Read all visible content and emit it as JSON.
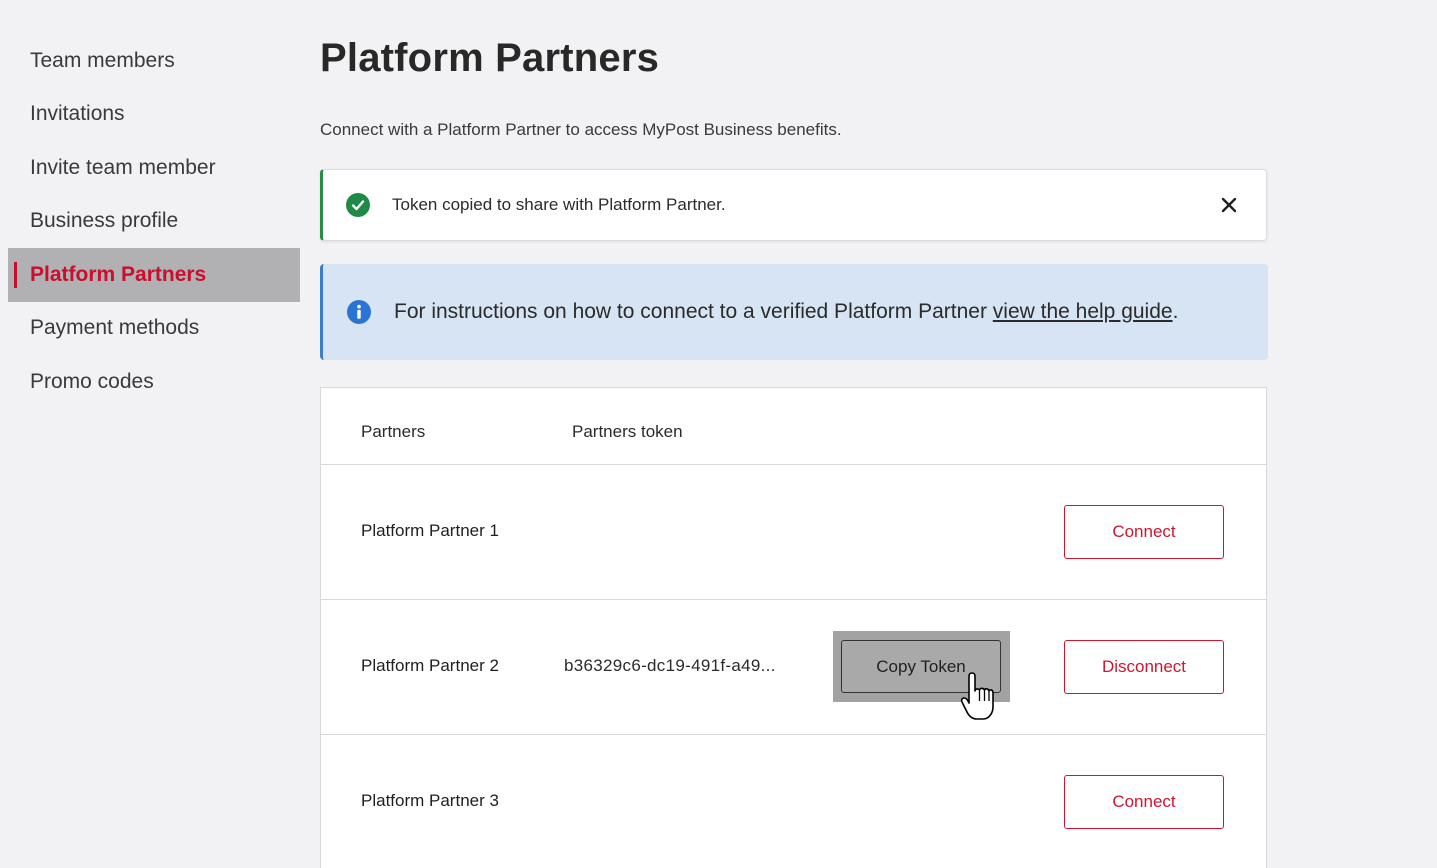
{
  "sidebar": {
    "items": [
      {
        "label": "Team members"
      },
      {
        "label": "Invitations"
      },
      {
        "label": "Invite team member"
      },
      {
        "label": "Business profile"
      },
      {
        "label": "Platform Partners",
        "active": true
      },
      {
        "label": "Payment methods"
      },
      {
        "label": "Promo codes"
      }
    ]
  },
  "page": {
    "title": "Platform Partners",
    "subtitle": "Connect with a Platform Partner to access MyPost Business benefits."
  },
  "toast": {
    "message": "Token copied to share with Platform Partner.",
    "icon": "check-circle-icon",
    "close_icon": "close-icon"
  },
  "info": {
    "text": "For instructions on how to connect to a verified Platform Partner ",
    "link_text": "view the help guide",
    "suffix": ".",
    "icon": "info-icon"
  },
  "table": {
    "headers": {
      "partners": "Partners",
      "token": "Partners token"
    },
    "rows": [
      {
        "name": "Platform Partner 1",
        "token": "",
        "action": "Connect"
      },
      {
        "name": "Platform Partner 2",
        "token": "b36329c6-dc19-491f-a49...",
        "copy_label": "Copy Token",
        "action": "Disconnect"
      },
      {
        "name": "Platform Partner 3",
        "token": "",
        "action": "Connect"
      }
    ]
  },
  "colors": {
    "accent_red": "#d1152f",
    "success_green": "#1e8a46",
    "info_blue": "#2a74d3",
    "info_bg": "#d6e4f3"
  }
}
